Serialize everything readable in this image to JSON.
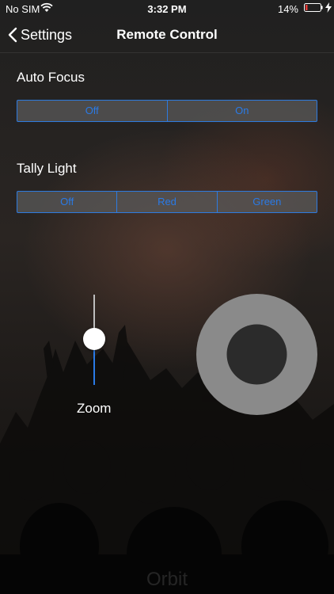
{
  "status_bar": {
    "carrier": "No SIM",
    "time": "3:32 PM",
    "battery_percent": "14%",
    "battery_level": 0.14
  },
  "nav": {
    "back_label": "Settings",
    "title": "Remote Control"
  },
  "auto_focus": {
    "label": "Auto Focus",
    "options": [
      "Off",
      "On"
    ]
  },
  "tally_light": {
    "label": "Tally Light",
    "options": [
      "Off",
      "Red",
      "Green"
    ]
  },
  "zoom": {
    "label": "Zoom",
    "value": 0.5
  },
  "brand": "Orbit",
  "colors": {
    "accent": "#2a7ae6",
    "segment_fill": "#5a5a5a",
    "joystick_ring": "#8a8a8a",
    "joystick_knob": "#2b2b2b",
    "battery_low": "#e53935"
  }
}
